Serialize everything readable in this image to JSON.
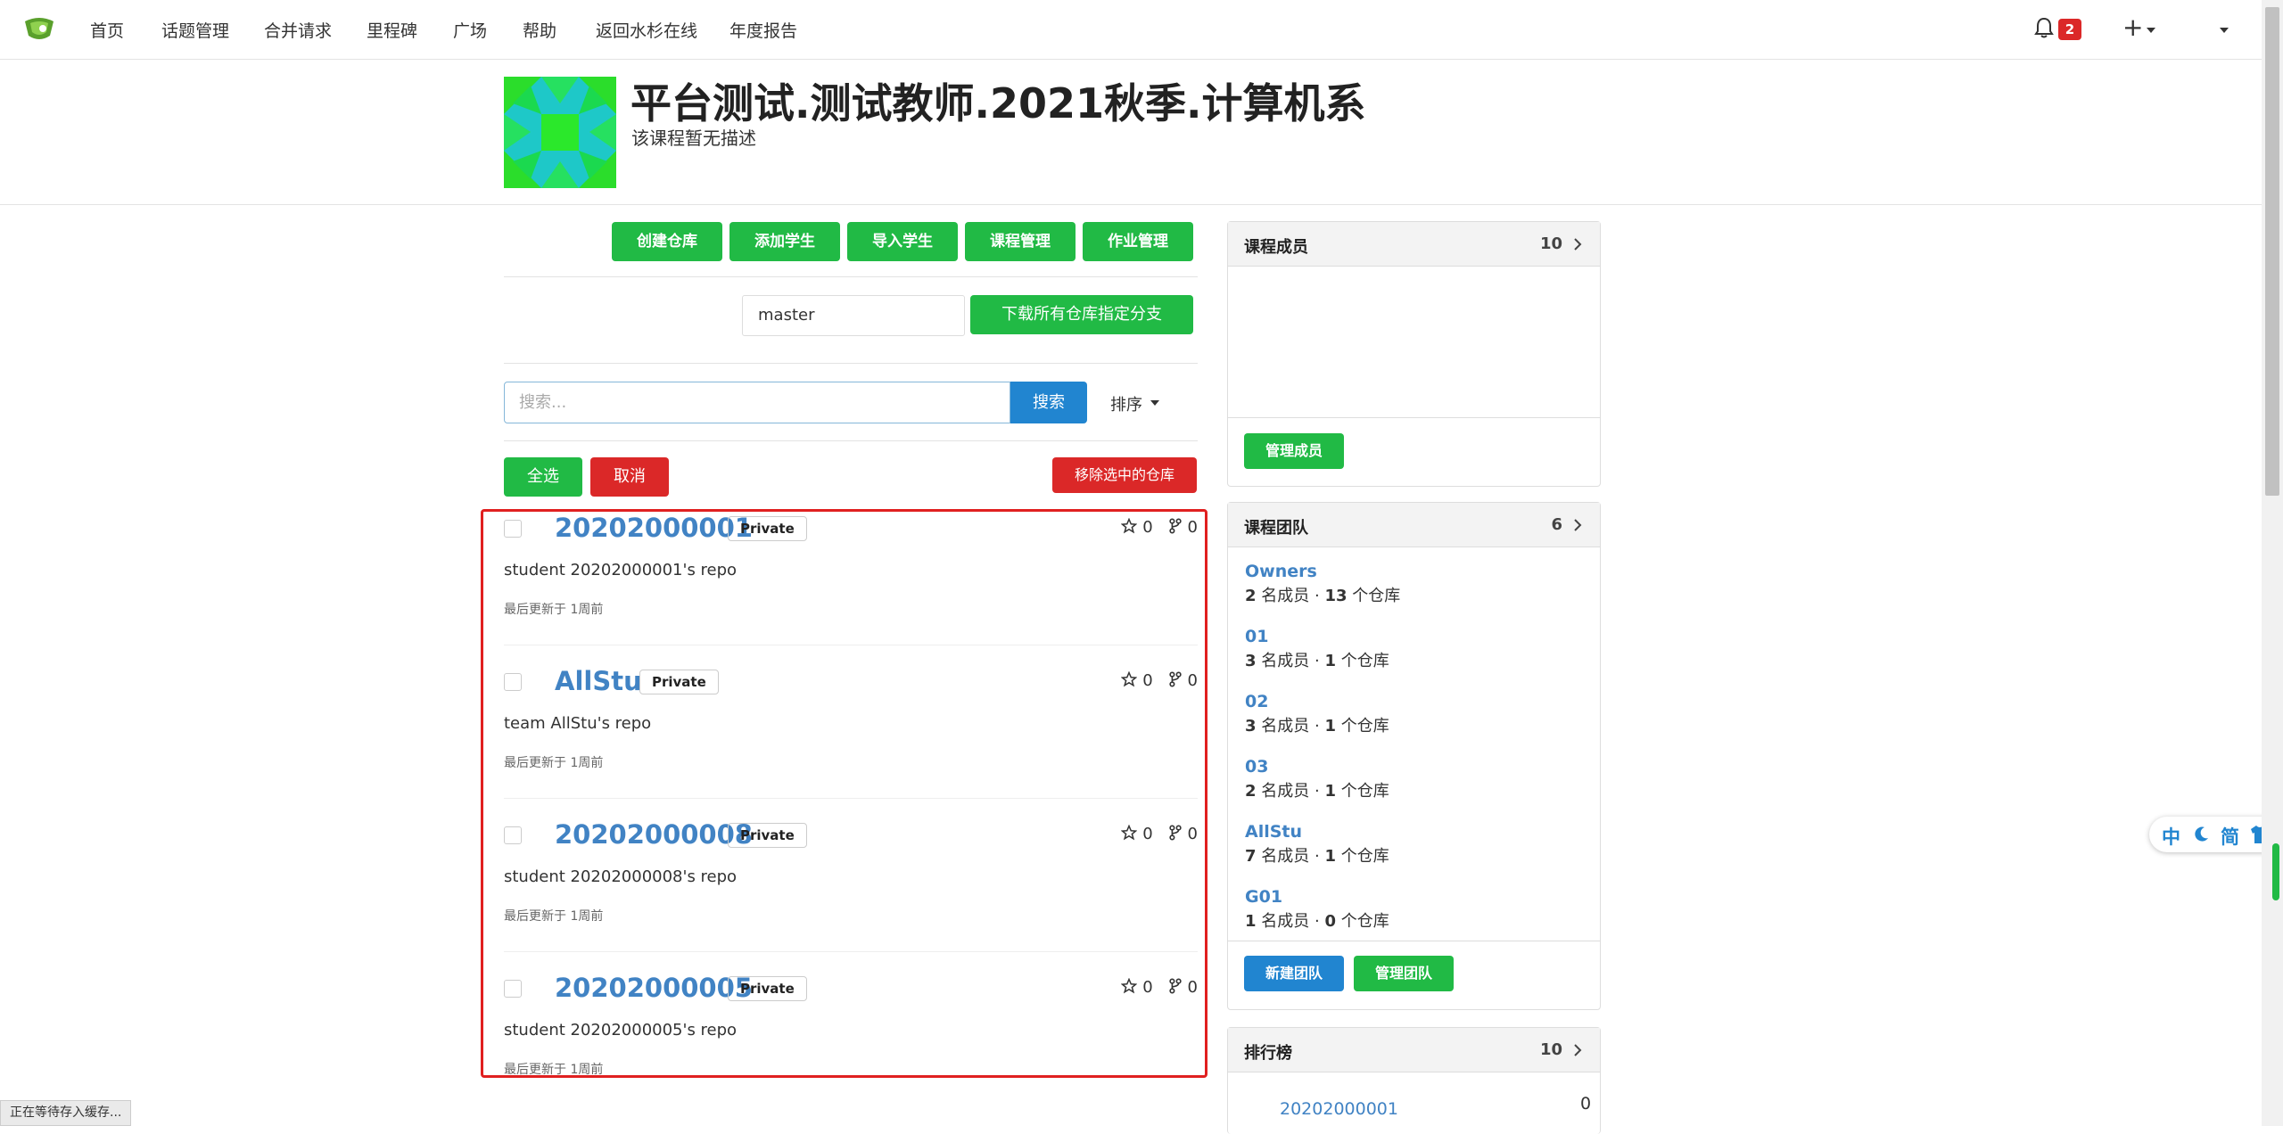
{
  "nav": {
    "items": [
      "首页",
      "话题管理",
      "合并请求",
      "里程碑",
      "广场",
      "帮助",
      "返回水杉在线",
      "年度报告"
    ],
    "notification_count": "2",
    "plus_label": "+"
  },
  "course": {
    "title": "平台测试.测试教师.2021秋季.计算机系",
    "description": "该课程暂无描述"
  },
  "actions": [
    "创建仓库",
    "添加学生",
    "导入学生",
    "课程管理",
    "作业管理"
  ],
  "branch": {
    "value": "master",
    "download_label": "下载所有仓库指定分支"
  },
  "search": {
    "placeholder": "搜索...",
    "button": "搜索",
    "sort": "排序"
  },
  "selection": {
    "select_all": "全选",
    "cancel": "取消",
    "remove_selected": "移除选中的仓库"
  },
  "repos": [
    {
      "name": "20202000001",
      "badge": "Private",
      "stars": "0",
      "forks": "0",
      "desc": "student 20202000001's repo",
      "updated": "最后更新于 1周前"
    },
    {
      "name": "AllStu",
      "badge": "Private",
      "stars": "0",
      "forks": "0",
      "desc": "team AllStu's repo",
      "updated": "最后更新于 1周前"
    },
    {
      "name": "20202000008",
      "badge": "Private",
      "stars": "0",
      "forks": "0",
      "desc": "student 20202000008's repo",
      "updated": "最后更新于 1周前"
    },
    {
      "name": "20202000005",
      "badge": "Private",
      "stars": "0",
      "forks": "0",
      "desc": "student 20202000005's repo",
      "updated": "最后更新于 1周前"
    }
  ],
  "members_panel": {
    "title": "课程成员",
    "count": "10",
    "manage_button": "管理成员"
  },
  "teams_panel": {
    "title": "课程团队",
    "count": "6",
    "teams": [
      {
        "name": "Owners",
        "members": "2",
        "repos": "13"
      },
      {
        "name": "01",
        "members": "3",
        "repos": "1"
      },
      {
        "name": "02",
        "members": "3",
        "repos": "1"
      },
      {
        "name": "03",
        "members": "2",
        "repos": "1"
      },
      {
        "name": "AllStu",
        "members": "7",
        "repos": "1"
      },
      {
        "name": "G01",
        "members": "1",
        "repos": "0"
      }
    ],
    "members_suffix": "名成员 ·",
    "repos_suffix": "个仓库",
    "new_team_button": "新建团队",
    "manage_team_button": "管理团队"
  },
  "ranking_panel": {
    "title": "排行榜",
    "count": "10",
    "first_name": "20202000001",
    "first_value": "0"
  },
  "lang_widget": {
    "zh": "中",
    "simplified": "简"
  },
  "status_bar": "正在等待存入缓存..."
}
